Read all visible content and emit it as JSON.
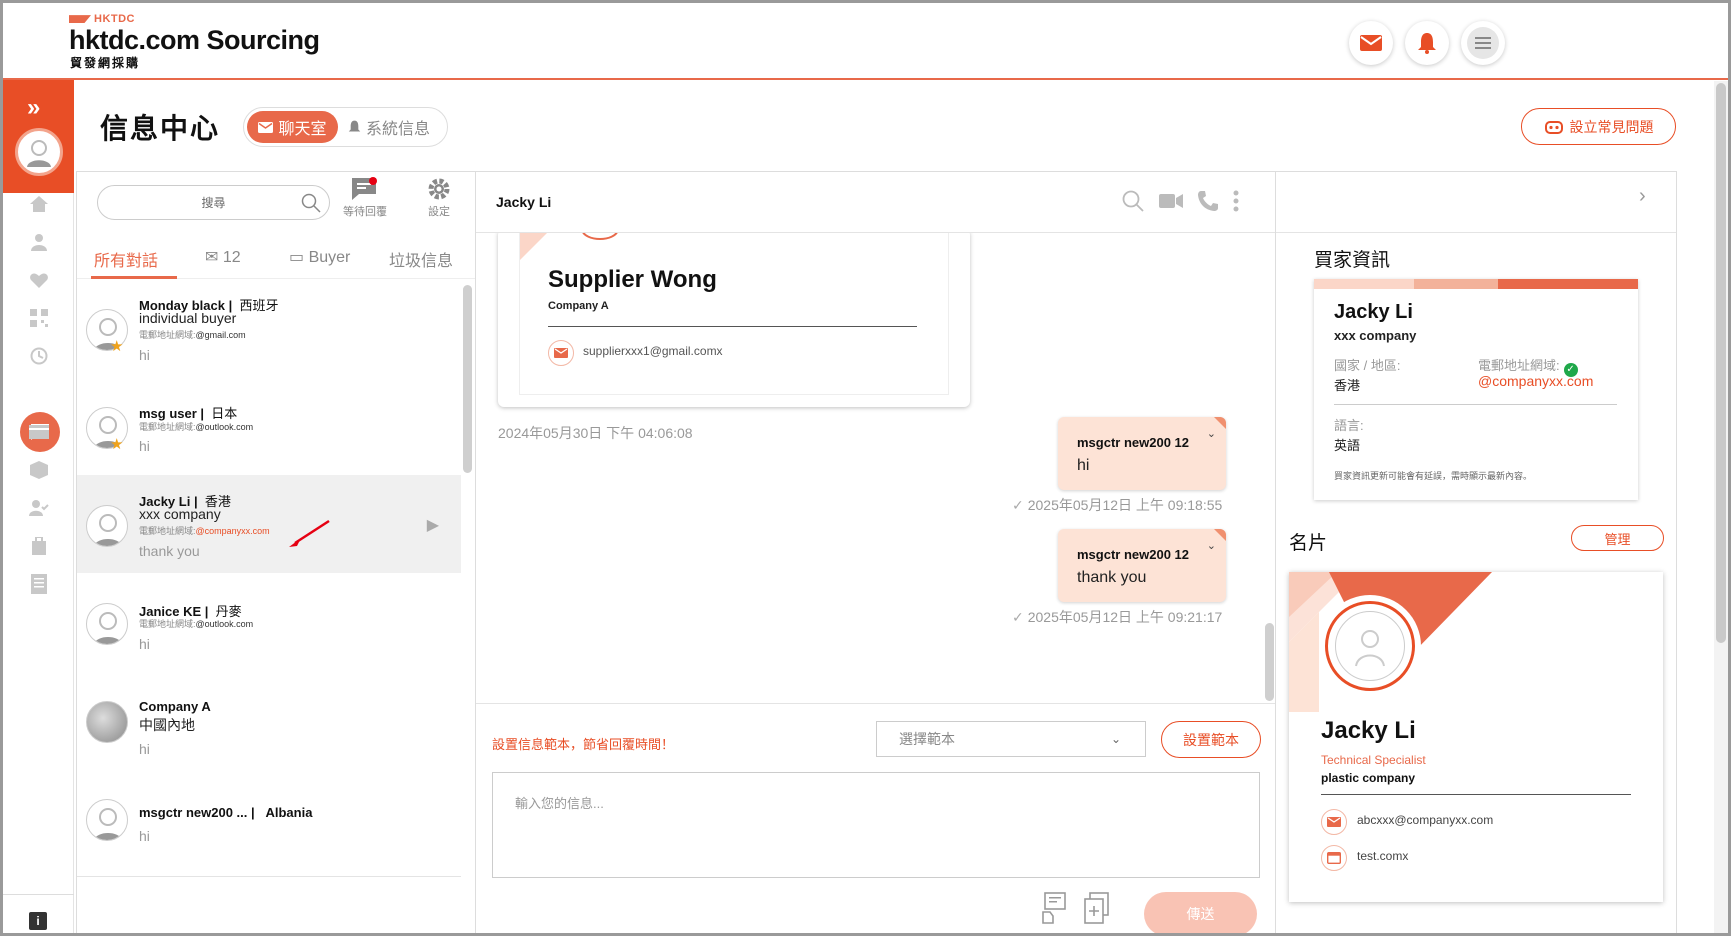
{
  "header": {
    "brand_small": "HKTDC",
    "brand_main": "hktdc.com Sourcing",
    "brand_sub": "貿發網採購",
    "icons": [
      "mail-icon",
      "bell-icon",
      "menu-icon"
    ],
    "accent": "#e8694a"
  },
  "page": {
    "title": "信息中心",
    "tab_chat": "聊天室",
    "tab_system": "系統信息",
    "faq_button": "設立常見問題"
  },
  "conversations": {
    "search_placeholder": "搜尋",
    "tool_waiting": "等待回覆",
    "tool_settings": "設定",
    "tabs": [
      "所有對話",
      "12",
      "Buyer",
      "垃圾信息"
    ],
    "items": [
      {
        "name": "Monday black",
        "country": "西班牙",
        "subtitle": "individual buyer",
        "email_label": "電郵地址網域:",
        "email": "@gmail.com",
        "last": "hi"
      },
      {
        "name": "msg user",
        "country": "日本",
        "subtitle": "",
        "email_label": "電郵地址網域:",
        "email": "@outlook.com",
        "last": "hi"
      },
      {
        "name": "Jacky Li",
        "country": "香港",
        "subtitle": "xxx company",
        "email_label": "電郵地址網域:",
        "email": "@companyxx.com",
        "last": "thank you"
      },
      {
        "name": "Janice KE",
        "country": "丹麥",
        "subtitle": "",
        "email_label": "電郵地址網域:",
        "email": "@outlook.com",
        "last": "hi"
      },
      {
        "name": "Company A",
        "country": "",
        "subtitle": "中國內地",
        "email_label": "",
        "email": "",
        "last": "hi"
      },
      {
        "name": "msgctr new200 ...",
        "country": "Albania",
        "subtitle": "",
        "email_label": "",
        "email": "",
        "last": "hi"
      }
    ]
  },
  "chat": {
    "title": "Jacky Li",
    "card": {
      "name": "Supplier Wong",
      "company": "Company A",
      "email": "supplierxxx1@gmail.comx"
    },
    "card_time": "2024年05月30日 下午 04:06:08",
    "messages": [
      {
        "sender": "msgctr new200 12",
        "text": "hi",
        "time": "2025年05月12日 上午 09:18:55"
      },
      {
        "sender": "msgctr new200 12",
        "text": "thank you",
        "time": "2025年05月12日 上午 09:21:17"
      }
    ],
    "template_hint": "設置信息範本，節省回覆時間！",
    "template_select": "選擇範本",
    "template_button": "設置範本",
    "input_placeholder": "輸入您的信息...",
    "send_button": "傳送"
  },
  "buyer_info": {
    "title": "買家資訊",
    "name": "Jacky Li",
    "company": "xxx company",
    "country_label": "國家 / 地區:",
    "country": "香港",
    "email_label": "電郵地址網域:",
    "email": "@companyxx.com",
    "language_label": "語言:",
    "language": "英語",
    "note": "買家資訊更新可能會有延誤，需時顯示最新內容。"
  },
  "namecard": {
    "title": "名片",
    "manage_button": "管理",
    "name": "Jacky Li",
    "role": "Technical Specialist",
    "company": "plastic company",
    "email": "abcxxx@companyxx.com",
    "website": "test.comx"
  }
}
